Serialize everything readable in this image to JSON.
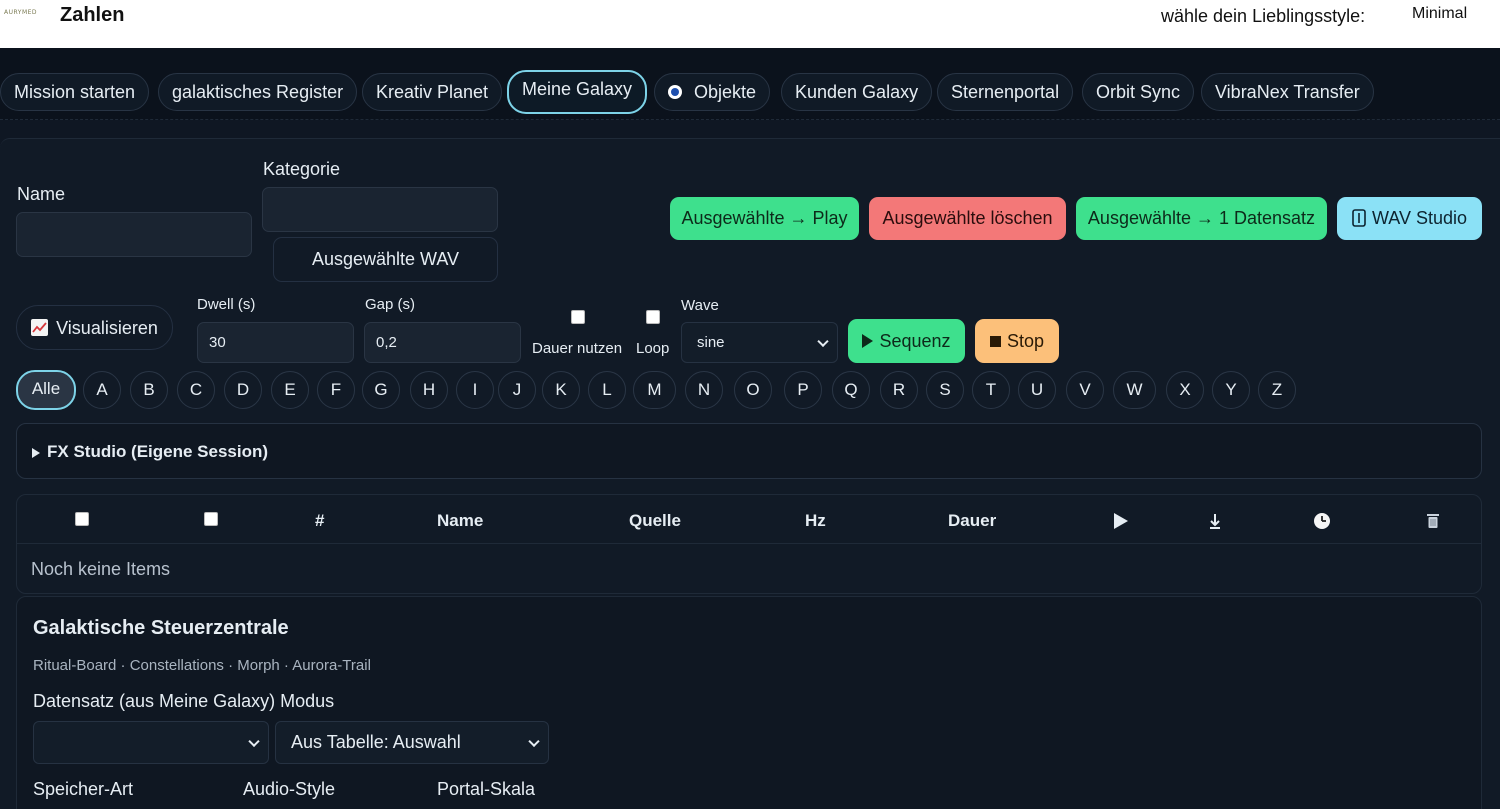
{
  "header": {
    "logo_text": "AURYMED",
    "title": "Zahlen",
    "style_label": "wähle dein Lieblingsstyle:",
    "style_value": "Minimal"
  },
  "nav": {
    "tabs": [
      {
        "label": "Mission starten"
      },
      {
        "label": "galaktisches Register"
      },
      {
        "label": "Kreativ Planet"
      },
      {
        "label": "Meine Galaxy"
      },
      {
        "label": "Objekte"
      },
      {
        "label": "Kunden Galaxy"
      },
      {
        "label": "Sternenportal"
      },
      {
        "label": "Orbit Sync"
      },
      {
        "label": "VibraNex Transfer"
      }
    ],
    "active": "Meine Galaxy"
  },
  "form": {
    "name_label": "Name",
    "name_value": "",
    "kategorie_label": "Kategorie",
    "kategorie_value": "",
    "wav_button": "Ausgewählte WAV",
    "btn_play": "Ausgewählte → Play",
    "btn_delete": "Ausgewählte löschen",
    "btn_dataset": "Ausgewählte → 1 Datensatz",
    "btn_wav_studio": "WAV Studio",
    "visualize_label": "Visualisieren",
    "dwell_label": "Dwell (s)",
    "dwell_value": "30",
    "gap_label": "Gap (s)",
    "gap_value": "0,2",
    "dauer_label": "Dauer nutzen",
    "loop_label": "Loop",
    "wave_label": "Wave",
    "wave_value": "sine",
    "btn_sequence": "Sequenz",
    "btn_stop": "Stop"
  },
  "letters": {
    "items": [
      "Alle",
      "A",
      "B",
      "C",
      "D",
      "E",
      "F",
      "G",
      "H",
      "I",
      "J",
      "K",
      "L",
      "M",
      "N",
      "O",
      "P",
      "Q",
      "R",
      "S",
      "T",
      "U",
      "V",
      "W",
      "X",
      "Y",
      "Z"
    ],
    "active": "Alle"
  },
  "fx_studio": {
    "title": "FX Studio (Eigene Session)"
  },
  "table": {
    "columns": [
      "#",
      "Name",
      "Quelle",
      "Hz",
      "Dauer"
    ],
    "empty_text": "Noch keine Items"
  },
  "steuerzentrale": {
    "title": "Galaktische Steuerzentrale",
    "subtitle": "Ritual-Board · Constellations · Morph · Aurora-Trail",
    "datensatz_label": "Datensatz (aus Meine Galaxy) Modus",
    "datensatz_value": "",
    "modus_value": "Aus Tabelle: Auswahl",
    "speicher_label": "Speicher-Art",
    "audio_label": "Audio-Style",
    "portal_label": "Portal-Skala"
  },
  "colors": {
    "background": "#0f1723",
    "accent_cyan": "#7dd3e8",
    "green": "#3ee08d",
    "red": "#f37878",
    "orange": "#fcc07a"
  }
}
